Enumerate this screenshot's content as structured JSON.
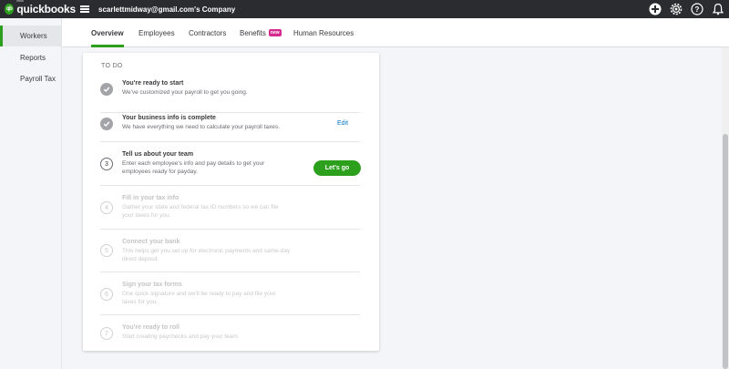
{
  "header": {
    "logo_brand": "intuit",
    "logo_text": "quickbooks",
    "logo_mark": "qb",
    "company": "scarlettmidway@gmail.com's Company",
    "icons": [
      "plus-icon",
      "gear-icon",
      "help-icon",
      "bell-icon"
    ]
  },
  "sidebar": {
    "items": [
      {
        "label": "Workers"
      },
      {
        "label": "Reports"
      },
      {
        "label": "Payroll Tax"
      }
    ]
  },
  "tabs": {
    "items": [
      {
        "label": "Overview"
      },
      {
        "label": "Employees"
      },
      {
        "label": "Contractors"
      },
      {
        "label": "Benefits",
        "badge": "new"
      },
      {
        "label": "Human Resources"
      }
    ]
  },
  "todo": {
    "title": "TO DO",
    "steps": [
      {
        "status": "done",
        "title": "You're ready to start",
        "desc": "We've customized your payroll to get you going."
      },
      {
        "status": "done",
        "title": "Your business info is complete",
        "desc": "We have everything we need to calculate your payroll taxes.",
        "action": "Edit"
      },
      {
        "status": "current",
        "number": "3",
        "title": "Tell us about your team",
        "desc": "Enter each employee's info and pay details to get your employees ready for payday.",
        "action": "Let's go"
      },
      {
        "status": "pending",
        "number": "4",
        "title": "Fill in your tax info",
        "desc": "Gather your state and federal tax ID numbers so we can file your taxes for you."
      },
      {
        "status": "pending",
        "number": "5",
        "title": "Connect your bank",
        "desc": "This helps get you set up for electronic payments and same-day direct deposit."
      },
      {
        "status": "pending",
        "number": "6",
        "title": "Sign your tax forms",
        "desc": "One quick signature and we'll be ready to pay and file your taxes for you."
      },
      {
        "status": "pending",
        "number": "7",
        "title": "You're ready to roll",
        "desc": "Start creating paychecks and pay your team."
      }
    ]
  },
  "colors": {
    "accent_green": "#2ca01c",
    "topbar": "#2b2c2f",
    "link_blue": "#0077c5",
    "badge_pink": "#d52b8f"
  }
}
